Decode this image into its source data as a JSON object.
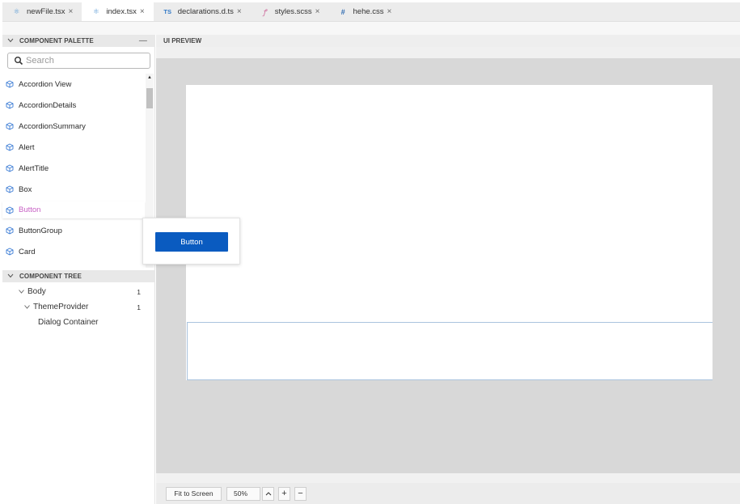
{
  "tabs": [
    {
      "label": "newFile.tsx",
      "icon": "react-icon",
      "active": false
    },
    {
      "label": "index.tsx",
      "icon": "react-icon",
      "active": true
    },
    {
      "label": "declarations.d.ts",
      "icon": "typescript-icon",
      "active": false
    },
    {
      "label": "styles.scss",
      "icon": "sass-icon",
      "active": false
    },
    {
      "label": "hehe.css",
      "icon": "css-icon",
      "active": false
    }
  ],
  "tab_glyphs": {
    "ts": "TS",
    "css": "#",
    "close": "×"
  },
  "palette": {
    "title": "COMPONENT PALETTE",
    "collapse_glyph": "—",
    "search_placeholder": "Search",
    "items": [
      "Accordion View",
      "AccordionDetails",
      "AccordionSummary",
      "Alert",
      "AlertTitle",
      "Box",
      "Button",
      "ButtonGroup",
      "Card"
    ],
    "hovered_item": "Button"
  },
  "tree": {
    "title": "COMPONENT TREE",
    "items": [
      {
        "label": "Body",
        "count": "1"
      },
      {
        "label": "ThemeProvider",
        "count": "1"
      },
      {
        "label": "Dialog Container",
        "count": ""
      }
    ]
  },
  "preview": {
    "title": "UI PREVIEW",
    "fit_label": "Fit to Screen",
    "zoom_value": "50%",
    "zoom_up": "^",
    "zoom_in": "+",
    "zoom_out": "−"
  },
  "tooltip": {
    "button_label": "Button"
  },
  "colors": {
    "accent": "#0a5bc0",
    "hover_text": "#c760c4",
    "react_icon": "#5a9bd5",
    "ts_icon": "#3178c6",
    "sass_icon": "#cd6799"
  }
}
